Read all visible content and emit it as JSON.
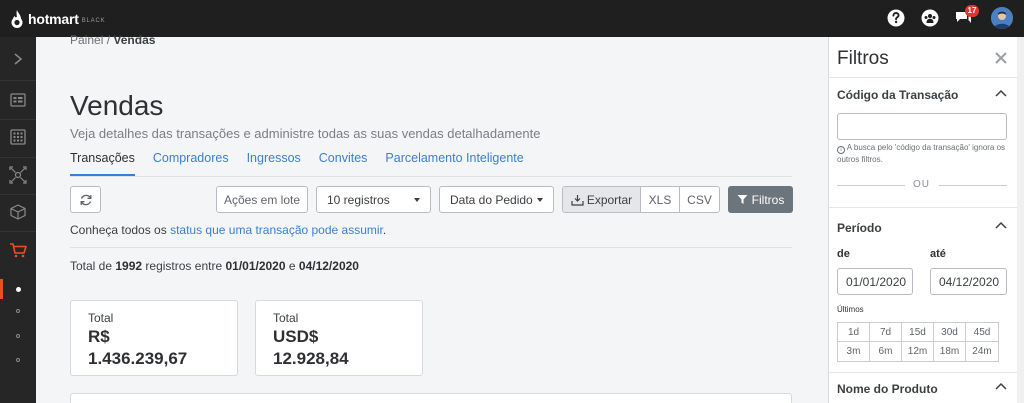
{
  "app": {
    "logo_text": "hotmart",
    "logo_sub": "BLACK",
    "notification_count": "17",
    "colors": {
      "topbar": "#1f1f1f",
      "sidebar": "#262626",
      "accent": "#ef4e23",
      "link": "#3b7ed6",
      "filters_button": "#6c747c"
    }
  },
  "topbar_icons": [
    "help-icon",
    "community-icon",
    "chat-icon",
    "avatar"
  ],
  "sidebar_icons": [
    "chevron-right-icon",
    "dashboard-icon",
    "apps-grid-icon",
    "network-icon",
    "box-icon",
    "cart-icon"
  ],
  "breadcrumb": {
    "parent": "Painel",
    "separator": "/",
    "current": "Vendas"
  },
  "page": {
    "title": "Vendas",
    "subtitle": "Veja detalhes das transações e administre todas as suas vendas detalhadamente"
  },
  "tabs": [
    {
      "label": "Transações",
      "active": true
    },
    {
      "label": "Compradores"
    },
    {
      "label": "Ingressos"
    },
    {
      "label": "Convites"
    },
    {
      "label": "Parcelamento Inteligente"
    }
  ],
  "toolbar": {
    "batch_actions": "Ações em lote",
    "records_select": "10 registros",
    "sort_select": "Data do Pedido",
    "export_label": "Exportar",
    "xls_label": "XLS",
    "csv_label": "CSV",
    "filters_label": "Filtros"
  },
  "info": {
    "prefix": "Conheça todos os",
    "link": "status que uma transação pode assumir",
    "suffix": "."
  },
  "summary": {
    "prefix": "Total de",
    "count": "1992",
    "mid": "registros entre",
    "from": "01/01/2020",
    "and": "e",
    "to": "04/12/2020"
  },
  "cards": [
    {
      "label": "Total",
      "currency": "R$",
      "value": "1.436.239,67"
    },
    {
      "label": "Total",
      "currency": "USD$",
      "value": "12.928,84"
    }
  ],
  "filters_panel": {
    "title": "Filtros",
    "transaction_code": {
      "title": "Código da Transação",
      "value": "",
      "hint": "A busca pelo 'código da transação' ignora os outros filtros."
    },
    "or_label": "OU",
    "period": {
      "title": "Período",
      "from_label": "de",
      "to_label": "até",
      "from_value": "01/01/2020",
      "to_value": "04/12/2020",
      "last_label": "Últimos",
      "options": [
        "1d",
        "7d",
        "15d",
        "30d",
        "45d",
        "3m",
        "6m",
        "12m",
        "18m",
        "24m"
      ]
    },
    "product_name": {
      "title": "Nome do Produto"
    }
  }
}
